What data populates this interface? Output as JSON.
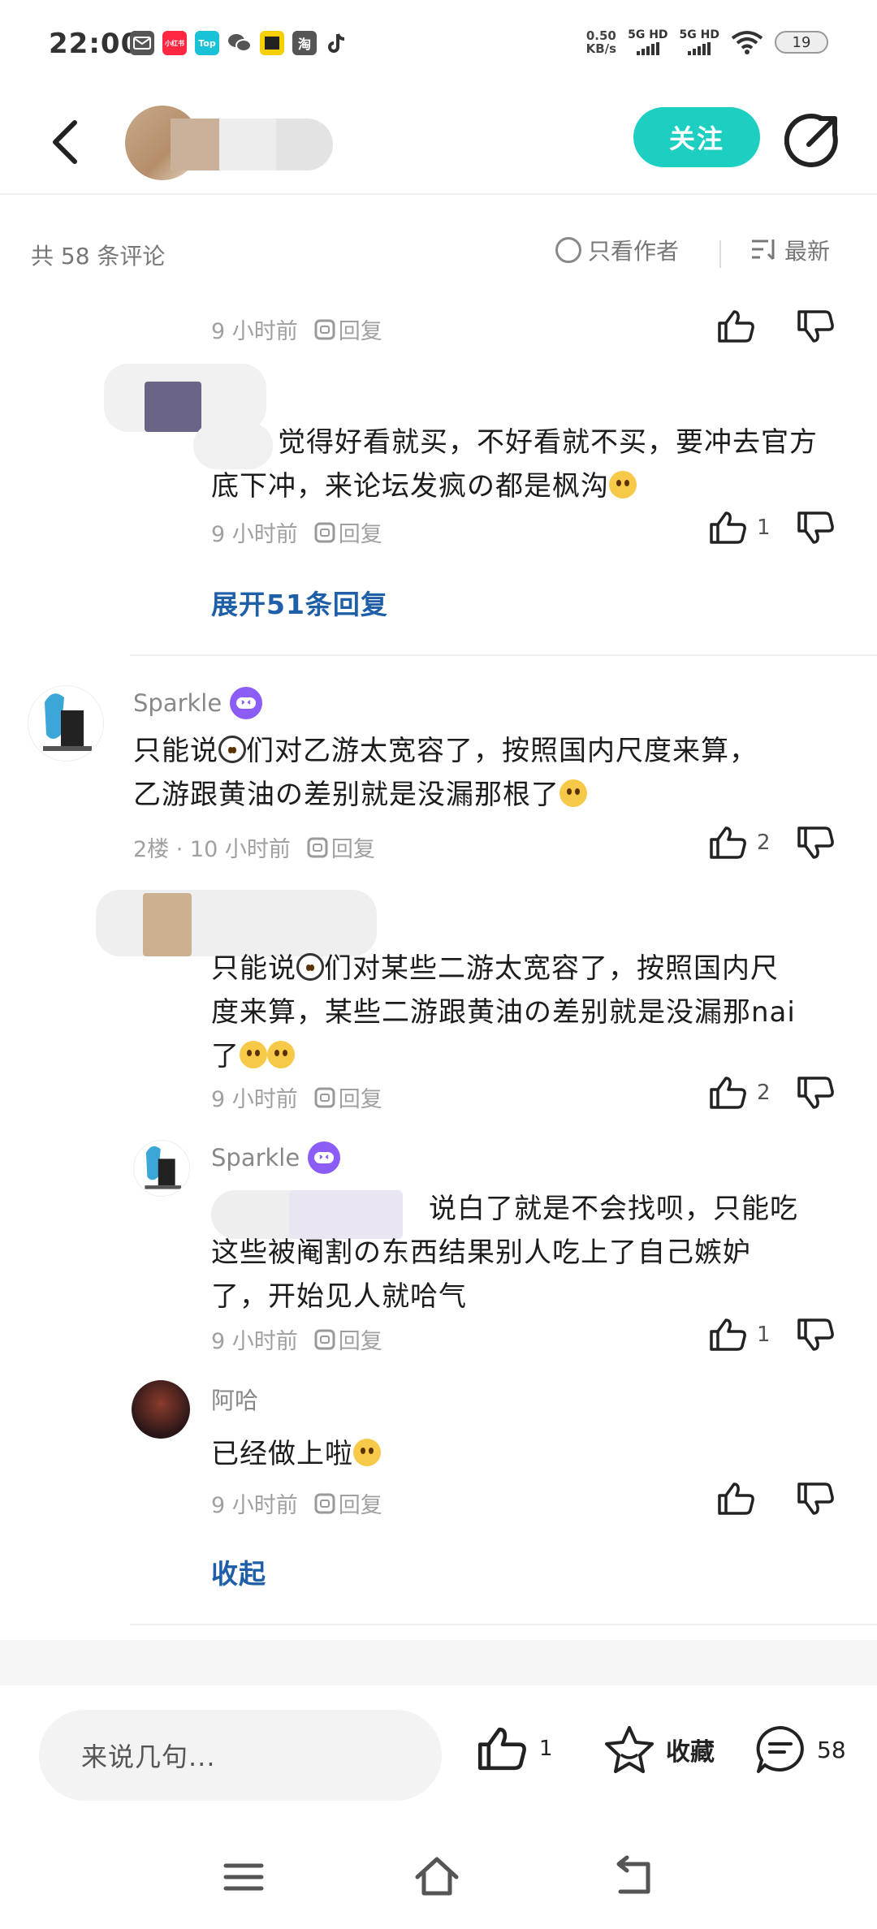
{
  "status": {
    "time": "22:00",
    "speed_value": "0.50",
    "speed_unit": "KB/s",
    "net1": "5G HD",
    "net2": "5G HD",
    "battery": "19",
    "app_icons": [
      {
        "name": "mail-icon",
        "label": "",
        "color": "#555555"
      },
      {
        "name": "xiaohongshu-icon",
        "label": "小红书",
        "color": "#ff2741"
      },
      {
        "name": "top-icon",
        "label": "Top",
        "color": "#19c2d6"
      },
      {
        "name": "wechat-icon",
        "label": "",
        "color": "#555555"
      },
      {
        "name": "video-icon",
        "label": "",
        "color": "#f5d000"
      },
      {
        "name": "taobao-icon",
        "label": "淘",
        "color": "#555555"
      },
      {
        "name": "tiktok-icon",
        "label": "",
        "color": "#333333"
      }
    ]
  },
  "nav": {
    "follow_label": "关注"
  },
  "header": {
    "count": "共 58 条评论",
    "author_only": "只看作者",
    "sort": "最新"
  },
  "comments": [
    {
      "meta_time": "9 小时前",
      "reply": "回复"
    },
    {
      "text": "觉得好看就买，不好看就不买，要冲去官方底下冲，来论坛发疯の都是枫沟",
      "meta_time": "9 小时前",
      "reply": "回复",
      "likes": "1"
    },
    {
      "expand": "展开51条回复"
    },
    {
      "name": "Sparkle",
      "text_line1": "只能说",
      "text_line1b": "们对乙游太宽容了，按照国内尺度来算，",
      "text_line2": "乙游跟黄油の差别就是没漏那根了",
      "meta_floor": "2楼 · 10 小时前",
      "reply": "回复",
      "likes": "2"
    },
    {
      "text_line1": "只能说",
      "text_line1b": "们对某些二游太宽容了，按照国内尺",
      "text_line2": "度来算，某些二游跟黄油の差别就是没漏那nai",
      "text_line3": "了",
      "meta_time": "9 小时前",
      "reply": "回复",
      "likes": "2"
    },
    {
      "name": "Sparkle",
      "text_line1": "说白了就是不会找呗，只能吃",
      "text_line2": "这些被阉割の东西结果别人吃上了自己嫉妒",
      "text_line3": "了，开始见人就哈气",
      "meta_time": "9 小时前",
      "reply": "回复",
      "likes": "1"
    },
    {
      "name": "阿哈",
      "text": "已经做上啦",
      "meta_time": "9 小时前",
      "reply": "回复"
    },
    {
      "collapse": "收起"
    }
  ],
  "bottom": {
    "input_placeholder": "来说几句...",
    "likes": "1",
    "favorite": "收藏",
    "comments": "58"
  },
  "colors": {
    "accent": "#1ccfc0",
    "link": "#1e5fa8",
    "badge": "#8b5cf6"
  }
}
